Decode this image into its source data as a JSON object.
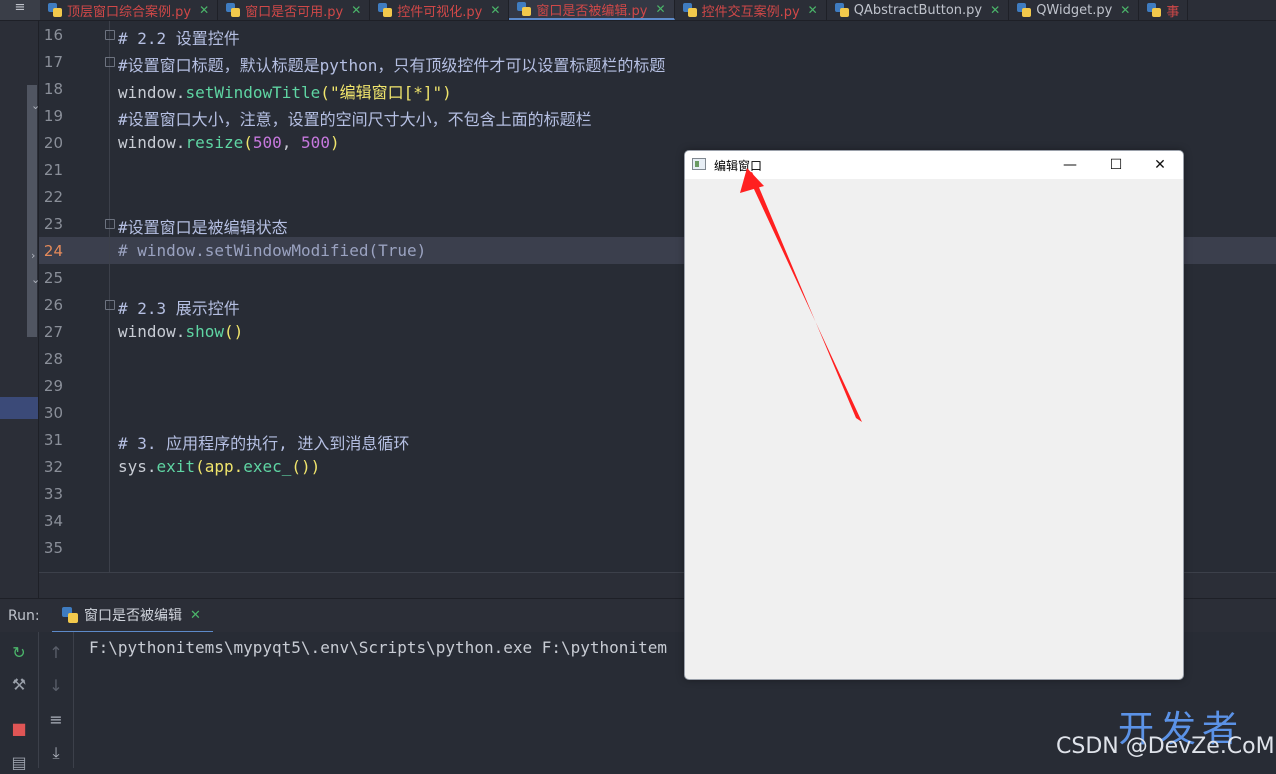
{
  "menu_icon": "≡",
  "tabs": [
    {
      "label": "顶层窗口综合案例.py",
      "state": "modified"
    },
    {
      "label": "窗口是否可用.py",
      "state": "modified"
    },
    {
      "label": "控件可视化.py",
      "state": "modified"
    },
    {
      "label": "窗口是否被编辑.py",
      "state": "active"
    },
    {
      "label": "控件交互案例.py",
      "state": "modified"
    },
    {
      "label": "QAbstractButton.py",
      "state": "normal"
    },
    {
      "label": "QWidget.py",
      "state": "normal"
    },
    {
      "label": "事",
      "state": "modified"
    }
  ],
  "tab_close": "✕",
  "editor": {
    "current_line": 24,
    "line_numbers": [
      "16",
      "17",
      "18",
      "19",
      "20",
      "21",
      "22",
      "23",
      "24",
      "25",
      "26",
      "27",
      "28",
      "29",
      "30",
      "31",
      "32",
      "33",
      "34",
      "35"
    ],
    "lines": {
      "l16": "# 2.2 设置控件",
      "l17": "#设置窗口标题，默认标题是python，只有顶级控件才可以设置标题栏的标题",
      "l18_obj": "window.",
      "l18_fn": "setWindowTitle",
      "l18_open": "(",
      "l18_str": "\"编辑窗口[*]\"",
      "l18_close": ")",
      "l19": "#设置窗口大小，注意，设置的空间尺寸大小，不包含上面的标题栏",
      "l20_obj": "window.",
      "l20_fn": "resize",
      "l20_open": "(",
      "l20_a": "500",
      "l20_sep": ", ",
      "l20_b": "500",
      "l20_close": ")",
      "l23": "#设置窗口是被编辑状态",
      "l24": "# window.setWindowModified(True)",
      "l26": "# 2.3 展示控件",
      "l27_obj": "window.",
      "l27_fn": "show",
      "l27_paren": "()",
      "l31": "# 3. 应用程序的执行, 进入到消息循环",
      "l32_obj": "sys.",
      "l32_fn": "exit",
      "l32_mid": "(app.",
      "l32_fn2": "exec_",
      "l32_end": "())"
    }
  },
  "run_panel": {
    "label": "Run:",
    "tab_label": "窗口是否被编辑",
    "console_line": "F:\\pythonitems\\mypyqt5\\.env\\Scripts\\python.exe F:\\pythonitem"
  },
  "qt_window": {
    "title": "编辑窗口",
    "minimize": "—",
    "maximize": "☐",
    "close": "✕"
  },
  "watermark": {
    "big": "开发者",
    "small": "CSDN @DevZe.CoM"
  },
  "colors": {
    "arrow": "#ff2020",
    "modified_tab": "#d04848",
    "function": "#5fd5a3",
    "string": "#f0e56c",
    "number": "#c678dd"
  }
}
